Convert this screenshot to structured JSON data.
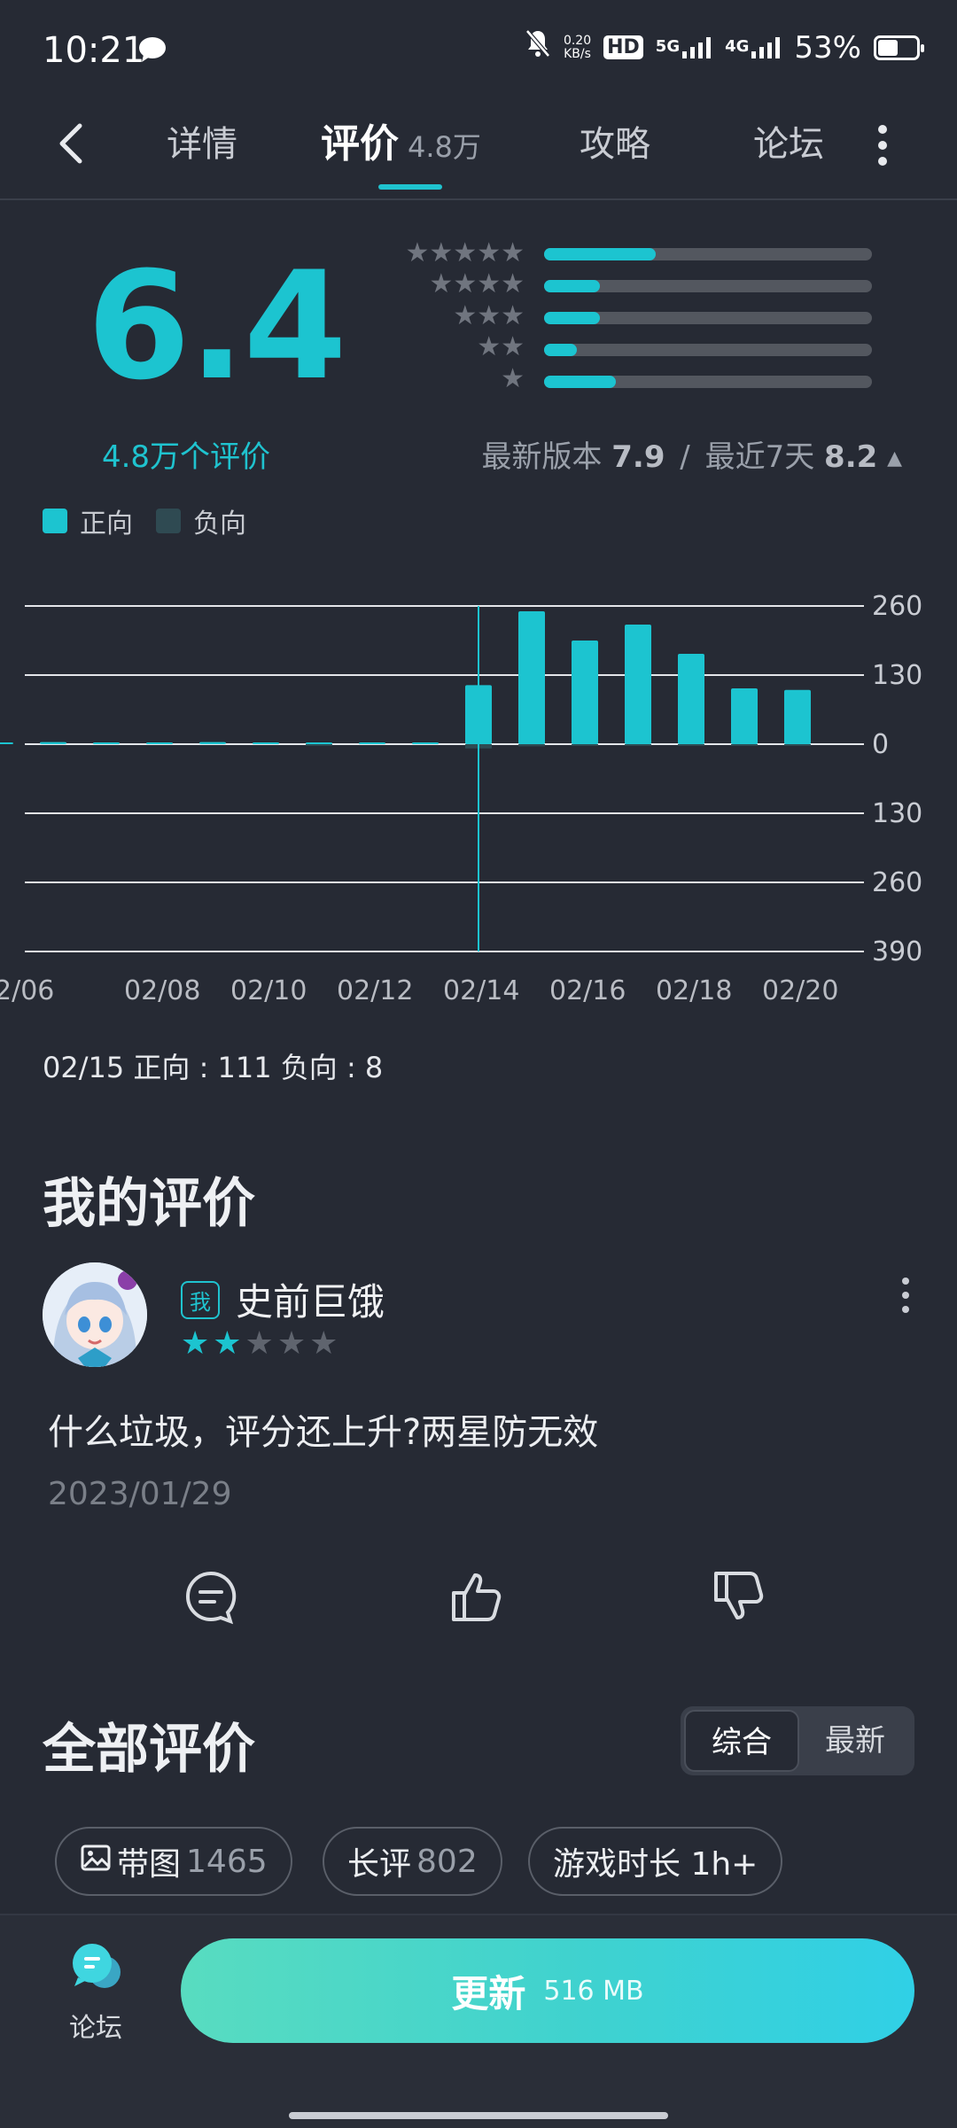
{
  "status": {
    "time": "10:21",
    "net_speed": "0.20",
    "net_unit": "KB/s",
    "hd": "HD",
    "sig1": "5G",
    "sig2": "4G",
    "battery": "53%"
  },
  "nav": {
    "tabs": [
      {
        "label": "详情"
      },
      {
        "label": "评价",
        "count": "4.8万"
      },
      {
        "label": "攻略"
      },
      {
        "label": "论坛"
      }
    ]
  },
  "rating": {
    "score": "6.4",
    "count_label": "4.8万个评价",
    "version_prefix": "最新版本",
    "version_score": "7.9",
    "separator": "/",
    "recent_prefix": "最近7天",
    "recent_score": "8.2",
    "distribution": [
      {
        "stars": 5,
        "fraction": 0.34
      },
      {
        "stars": 4,
        "fraction": 0.17
      },
      {
        "stars": 3,
        "fraction": 0.17
      },
      {
        "stars": 2,
        "fraction": 0.1
      },
      {
        "stars": 1,
        "fraction": 0.22
      }
    ]
  },
  "legend": {
    "positive": "正向",
    "negative": "负向"
  },
  "colors": {
    "accent": "#1cc4d0",
    "negative": "#2f4a52",
    "bg": "#262a34"
  },
  "chart_data": {
    "type": "bar",
    "x": [
      "02/06",
      "02/07",
      "02/08",
      "02/09",
      "02/10",
      "02/11",
      "02/12",
      "02/13",
      "02/14",
      "02/15",
      "02/16",
      "02/17",
      "02/18",
      "02/19",
      "02/20",
      "02/21"
    ],
    "tick_labels": [
      "2/06",
      "02/08",
      "02/10",
      "02/12",
      "02/14",
      "02/16",
      "02/18",
      "02/20"
    ],
    "series": [
      {
        "name": "正向",
        "values": [
          2,
          4,
          3,
          2,
          4,
          2,
          1,
          3,
          3,
          111,
          250,
          195,
          225,
          170,
          105,
          102
        ]
      },
      {
        "name": "负向",
        "values": [
          0,
          0,
          0,
          0,
          0,
          0,
          1,
          0,
          0,
          -8,
          -4,
          -2,
          -3,
          -2,
          -1,
          -1
        ]
      }
    ],
    "y_ticks": [
      "260",
      "130",
      "0",
      "130",
      "260",
      "390"
    ],
    "ylim": [
      -390,
      260
    ],
    "selected": "02/15"
  },
  "tooltip": "02/15 正向 : 111  负向 : 8",
  "my_review": {
    "heading": "我的评价",
    "badge": "我",
    "username": "史前巨饿",
    "rating": 2,
    "text": "什么垃圾，评分还上升?两星防无效",
    "date": "2023/01/29"
  },
  "all_reviews": {
    "heading": "全部评价",
    "sort_options": [
      "综合",
      "最新"
    ],
    "filters": [
      {
        "label": "带图",
        "count": "1465"
      },
      {
        "label": "长评",
        "count": "802"
      },
      {
        "label": "游戏时长 1h+"
      }
    ]
  },
  "bottom": {
    "forum_label": "论坛",
    "update_label": "更新",
    "update_size": "516 MB"
  }
}
